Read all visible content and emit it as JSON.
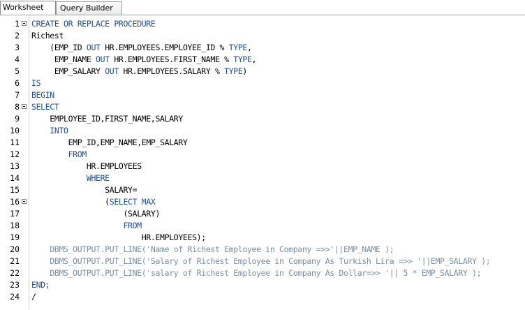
{
  "tabs": [
    {
      "label": "Worksheet",
      "active": true
    },
    {
      "label": "Query Builder",
      "active": false
    }
  ],
  "colors": {
    "keyword": "#1f4f96",
    "string": "#7a8fa8",
    "text": "#000000"
  },
  "editor": {
    "lines": [
      {
        "n": "1",
        "fold": true,
        "segs": [
          {
            "t": "CREATE OR REPLACE PROCEDURE",
            "c": "k"
          }
        ]
      },
      {
        "n": "2",
        "fold": false,
        "segs": [
          {
            "t": "Richest",
            "c": ""
          }
        ]
      },
      {
        "n": "3",
        "fold": false,
        "segs": [
          {
            "t": "    (EMP_ID ",
            "c": ""
          },
          {
            "t": "OUT",
            "c": "k"
          },
          {
            "t": " HR.EMPLOYEES.EMPLOYEE_ID % ",
            "c": ""
          },
          {
            "t": "TYPE",
            "c": "k"
          },
          {
            "t": ",",
            "c": ""
          }
        ]
      },
      {
        "n": "4",
        "fold": false,
        "segs": [
          {
            "t": "     EMP_NAME ",
            "c": ""
          },
          {
            "t": "OUT",
            "c": "k"
          },
          {
            "t": " HR.EMPLOYEES.FIRST_NAME % ",
            "c": ""
          },
          {
            "t": "TYPE",
            "c": "k"
          },
          {
            "t": ",",
            "c": ""
          }
        ]
      },
      {
        "n": "5",
        "fold": false,
        "segs": [
          {
            "t": "     EMP_SALARY ",
            "c": ""
          },
          {
            "t": "OUT",
            "c": "k"
          },
          {
            "t": " HR.EMPLOYEES.SALARY % ",
            "c": ""
          },
          {
            "t": "TYPE",
            "c": "k"
          },
          {
            "t": ")",
            "c": ""
          }
        ]
      },
      {
        "n": "6",
        "fold": false,
        "segs": [
          {
            "t": "IS",
            "c": "k"
          }
        ]
      },
      {
        "n": "7",
        "fold": false,
        "segs": [
          {
            "t": "BEGIN",
            "c": "k"
          }
        ]
      },
      {
        "n": "8",
        "fold": true,
        "segs": [
          {
            "t": "SELECT",
            "c": "k"
          }
        ]
      },
      {
        "n": "9",
        "fold": false,
        "segs": [
          {
            "t": "    EMPLOYEE_ID,FIRST_NAME,SALARY",
            "c": ""
          }
        ]
      },
      {
        "n": "10",
        "fold": false,
        "segs": [
          {
            "t": "    ",
            "c": ""
          },
          {
            "t": "INTO",
            "c": "k"
          }
        ]
      },
      {
        "n": "11",
        "fold": false,
        "segs": [
          {
            "t": "        EMP_ID,EMP_NAME,EMP_SALARY",
            "c": ""
          }
        ]
      },
      {
        "n": "12",
        "fold": false,
        "segs": [
          {
            "t": "        ",
            "c": ""
          },
          {
            "t": "FROM",
            "c": "k"
          }
        ]
      },
      {
        "n": "13",
        "fold": false,
        "segs": [
          {
            "t": "            HR.EMPLOYEES",
            "c": ""
          }
        ]
      },
      {
        "n": "14",
        "fold": false,
        "segs": [
          {
            "t": "            ",
            "c": ""
          },
          {
            "t": "WHERE",
            "c": "k"
          }
        ]
      },
      {
        "n": "15",
        "fold": false,
        "segs": [
          {
            "t": "                SALARY=",
            "c": ""
          }
        ]
      },
      {
        "n": "16",
        "fold": true,
        "segs": [
          {
            "t": "                (",
            "c": ""
          },
          {
            "t": "SELECT MAX",
            "c": "k"
          }
        ]
      },
      {
        "n": "17",
        "fold": false,
        "segs": [
          {
            "t": "                    (SALARY)",
            "c": ""
          }
        ]
      },
      {
        "n": "18",
        "fold": false,
        "segs": [
          {
            "t": "                    ",
            "c": ""
          },
          {
            "t": "FROM",
            "c": "k"
          }
        ]
      },
      {
        "n": "19",
        "fold": false,
        "segs": [
          {
            "t": "                        HR.EMPLOYEES);",
            "c": ""
          }
        ]
      },
      {
        "n": "20",
        "fold": false,
        "segs": [
          {
            "t": "    DBMS_OUTPUT.PUT_LINE('Name of Richest Employee in Company =>>'||EMP_NAME );",
            "c": "s"
          }
        ]
      },
      {
        "n": "21",
        "fold": false,
        "segs": [
          {
            "t": "    DBMS_OUTPUT.PUT_LINE('Salary of Richest Employee in Company As Turkish Lira =>> '||EMP_SALARY );",
            "c": "s"
          }
        ]
      },
      {
        "n": "22",
        "fold": false,
        "segs": [
          {
            "t": "    DBMS_OUTPUT.PUT_LINE('salary of Richest Employee in Company As Dollar=>> '|| 5 * EMP_SALARY );",
            "c": "s"
          }
        ]
      },
      {
        "n": "23",
        "fold": false,
        "segs": [
          {
            "t": "END;",
            "c": "k"
          }
        ]
      },
      {
        "n": "24",
        "fold": false,
        "segs": [
          {
            "t": "/",
            "c": ""
          }
        ]
      }
    ]
  }
}
